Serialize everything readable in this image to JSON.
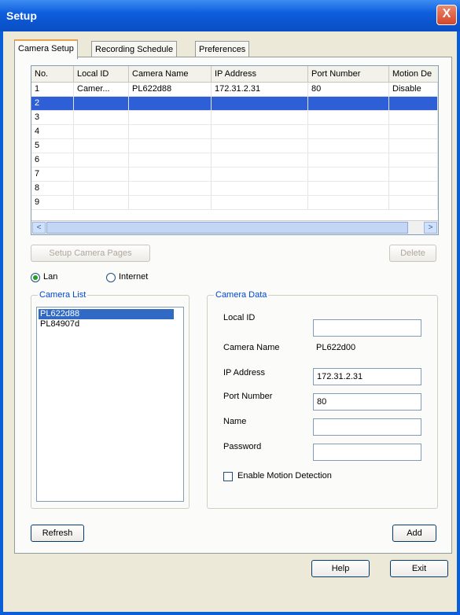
{
  "window": {
    "title": "Setup",
    "close": "X"
  },
  "tabs": [
    {
      "label": "Camera Setup"
    },
    {
      "label": "Recording Schedule"
    },
    {
      "label": "Preferences"
    }
  ],
  "grid": {
    "columns": [
      "No.",
      "Local ID",
      "Camera Name",
      "IP Address",
      "Port Number",
      "Motion De"
    ],
    "rows": [
      [
        "1",
        "Camer...",
        "PL622d88",
        "172.31.2.31",
        "80",
        "Disable"
      ],
      [
        "2",
        "",
        "",
        "",
        "",
        ""
      ],
      [
        "3",
        "",
        "",
        "",
        "",
        ""
      ],
      [
        "4",
        "",
        "",
        "",
        "",
        ""
      ],
      [
        "5",
        "",
        "",
        "",
        "",
        ""
      ],
      [
        "6",
        "",
        "",
        "",
        "",
        ""
      ],
      [
        "7",
        "",
        "",
        "",
        "",
        ""
      ],
      [
        "8",
        "",
        "",
        "",
        "",
        ""
      ],
      [
        "9",
        "",
        "",
        "",
        "",
        ""
      ]
    ],
    "selected_row": 2,
    "scroll_left": "<",
    "scroll_right": ">"
  },
  "buttons": {
    "setup_camera_pages": "Setup Camera Pages",
    "delete": "Delete",
    "refresh": "Refresh",
    "add": "Add",
    "help": "Help",
    "exit": "Exit"
  },
  "connection": {
    "lan": "Lan",
    "internet": "Internet",
    "selected": "Lan"
  },
  "camera_list": {
    "title": "Camera List",
    "items": [
      "PL622d88",
      "PL84907d"
    ],
    "selected": "PL622d88"
  },
  "camera_data": {
    "title": "Camera Data",
    "local_id_label": "Local ID",
    "local_id_value": "",
    "camera_name_label": "Camera Name",
    "camera_name_value": "PL622d00",
    "ip_label": "IP Address",
    "ip_value": "172.31.2.31",
    "port_label": "Port Number",
    "port_value": "80",
    "name_label": "Name",
    "name_value": "",
    "password_label": "Password",
    "password_value": "",
    "motion_label": "Enable Motion Detection",
    "motion_checked": false
  }
}
